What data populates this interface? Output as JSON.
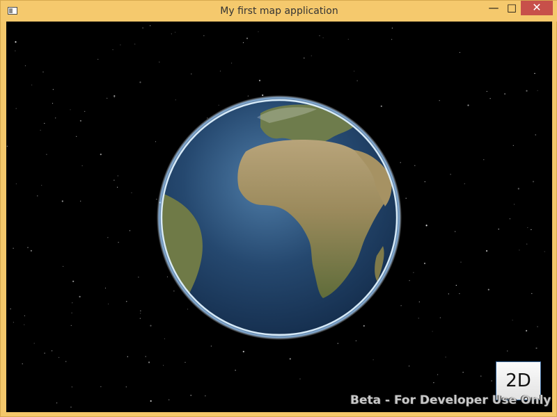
{
  "window": {
    "title": "My first map application",
    "minimize_glyph": "—",
    "maximize_glyph": "□",
    "close_glyph": "✕"
  },
  "map": {
    "view_mode_button": "2D",
    "watermark": "Beta - For Developer Use Only"
  },
  "icons": {
    "app": "app-window-icon",
    "minimize": "minimize-icon",
    "maximize": "maximize-icon",
    "close": "close-icon"
  },
  "colors": {
    "window_frame": "#f3c76a",
    "close_button": "#c7504a",
    "space": "#000000",
    "ocean": "#24456a",
    "land": "#8d8458",
    "atmosphere": "#d8ecff"
  }
}
